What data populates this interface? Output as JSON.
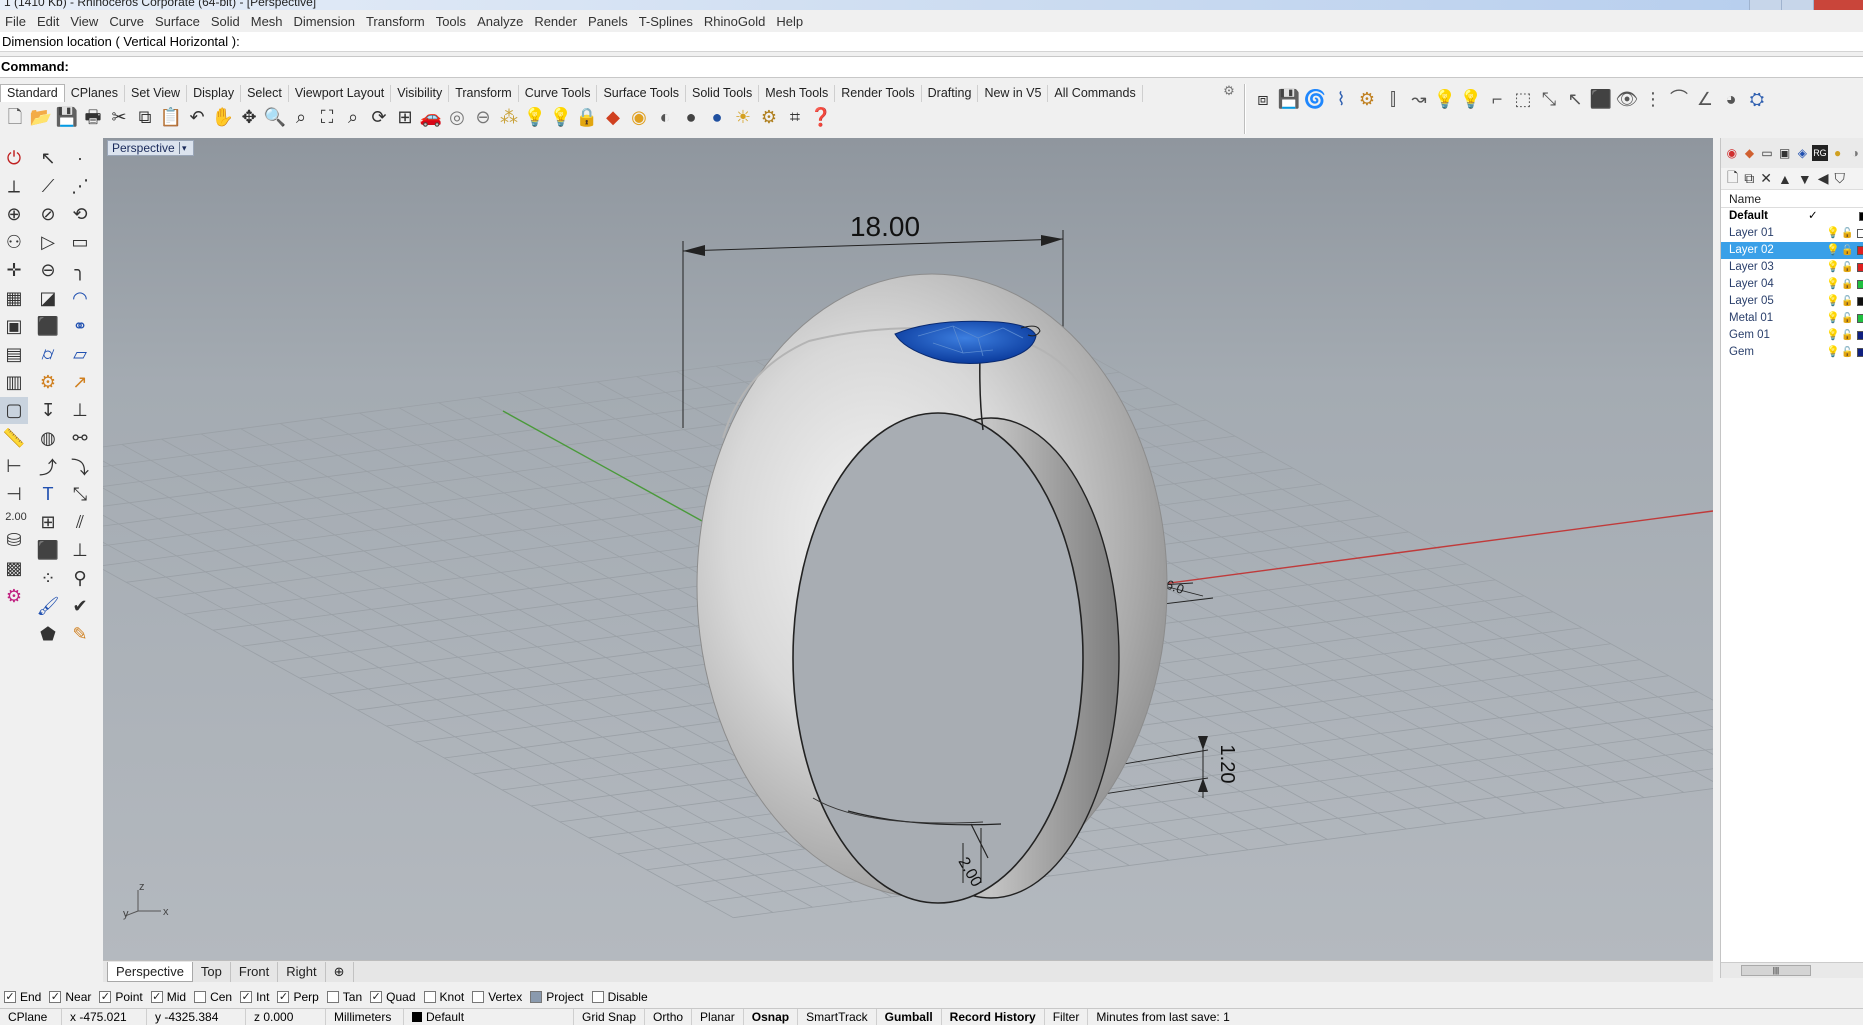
{
  "window": {
    "title": "1 (1410 Kb) - Rhinoceros Corporate (64-bit) - [Perspective]"
  },
  "menu": [
    "File",
    "Edit",
    "View",
    "Curve",
    "Surface",
    "Solid",
    "Mesh",
    "Dimension",
    "Transform",
    "Tools",
    "Analyze",
    "Render",
    "Panels",
    "T-Splines",
    "RhinoGold",
    "Help"
  ],
  "command": {
    "history": "Dimension location ( Vertical  Horizontal ):",
    "prompt": "Command:"
  },
  "toolbar_tabs": [
    "Standard",
    "CPlanes",
    "Set View",
    "Display",
    "Select",
    "Viewport Layout",
    "Visibility",
    "Transform",
    "Curve Tools",
    "Surface Tools",
    "Solid Tools",
    "Mesh Tools",
    "Render Tools",
    "Drafting",
    "New in V5",
    "All Commands"
  ],
  "left_tools_value": "2.00",
  "viewport": {
    "label": "Perspective",
    "dimensions": {
      "width": "18.00",
      "thickness": "1.20",
      "side": "2.00",
      "depth": "6.0"
    },
    "axis": {
      "z": "z",
      "y": "y",
      "x": "x"
    }
  },
  "view_tabs": [
    "Perspective",
    "Top",
    "Front",
    "Right"
  ],
  "layers": {
    "header": "Name",
    "rows": [
      {
        "name": "Default",
        "color": "#000000"
      },
      {
        "name": "Layer 01",
        "color": "#ffffff"
      },
      {
        "name": "Layer 02",
        "color": "#e02020"
      },
      {
        "name": "Layer 03",
        "color": "#e02020"
      },
      {
        "name": "Layer 04",
        "color": "#20c040"
      },
      {
        "name": "Layer 05",
        "color": "#101010"
      },
      {
        "name": "Metal 01",
        "color": "#20c040"
      },
      {
        "name": "Gem 01",
        "color": "#102080"
      },
      {
        "name": "Gem",
        "color": "#102080"
      }
    ],
    "selected": "Layer 02"
  },
  "osnap": [
    {
      "label": "End",
      "checked": true
    },
    {
      "label": "Near",
      "checked": true
    },
    {
      "label": "Point",
      "checked": true
    },
    {
      "label": "Mid",
      "checked": true
    },
    {
      "label": "Cen",
      "checked": false
    },
    {
      "label": "Int",
      "checked": true
    },
    {
      "label": "Perp",
      "checked": true
    },
    {
      "label": "Tan",
      "checked": false
    },
    {
      "label": "Quad",
      "checked": true
    },
    {
      "label": "Knot",
      "checked": false
    },
    {
      "label": "Vertex",
      "checked": false
    },
    {
      "label": "Project",
      "checked": false
    },
    {
      "label": "Disable",
      "checked": false
    }
  ],
  "status": {
    "cplane": "CPlane",
    "x": "x -475.021",
    "y": "y -4325.384",
    "z": "z 0.000",
    "units": "Millimeters",
    "layer": "Default",
    "toggles": [
      "Grid Snap",
      "Ortho",
      "Planar",
      "Osnap",
      "SmartTrack",
      "Gumball",
      "Record History",
      "Filter"
    ],
    "save": "Minutes from last save: 1"
  }
}
